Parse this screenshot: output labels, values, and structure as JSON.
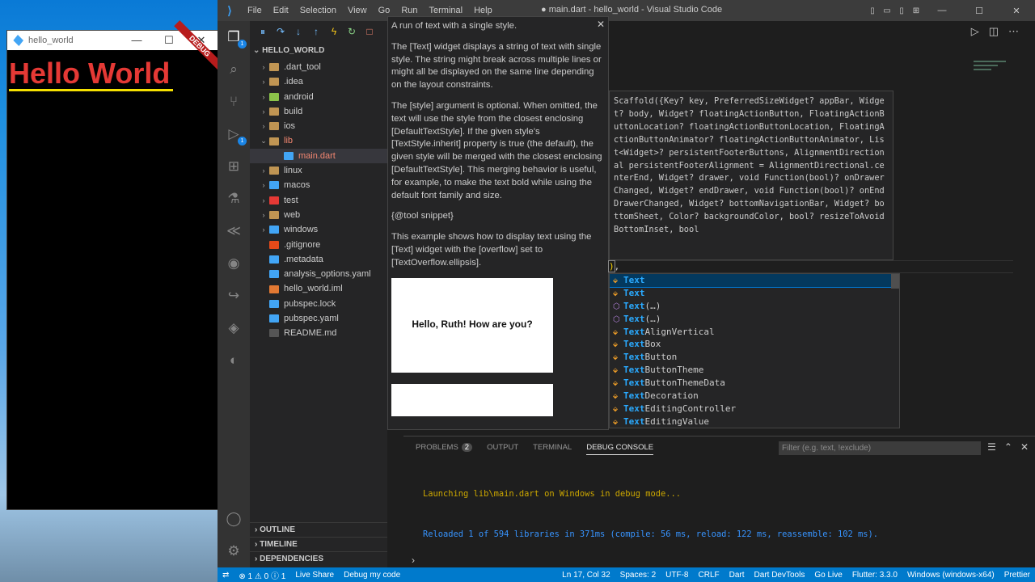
{
  "app_window": {
    "title": "hello_world",
    "hello_text": "Hello World",
    "debug_banner": "DEBUG",
    "minimize": "—",
    "maximize": "☐",
    "close": "✕"
  },
  "vscode": {
    "menus": [
      "File",
      "Edit",
      "Selection",
      "View",
      "Go",
      "Run",
      "Terminal",
      "Help"
    ],
    "title": "● main.dart - hello_world - Visual Studio Code",
    "activity_badges": {
      "explorer": "1",
      "run": "1"
    }
  },
  "explorer": {
    "root": "HELLO_WORLD",
    "items": [
      {
        "label": ".dart_tool",
        "chev": "›",
        "color": "#c09553"
      },
      {
        "label": ".idea",
        "chev": "›",
        "color": "#c09553"
      },
      {
        "label": "android",
        "chev": "›",
        "color": "#8bc34a"
      },
      {
        "label": "build",
        "chev": "›",
        "color": "#c09553"
      },
      {
        "label": "ios",
        "chev": "›",
        "color": "#c09553"
      },
      {
        "label": "lib",
        "chev": "⌄",
        "color": "#c09553"
      },
      {
        "label": "main.dart",
        "chev": "",
        "color": "#42a5f5"
      },
      {
        "label": "linux",
        "chev": "›",
        "color": "#c09553"
      },
      {
        "label": "macos",
        "chev": "›",
        "color": "#42a5f5"
      },
      {
        "label": "test",
        "chev": "›",
        "color": "#e53935"
      },
      {
        "label": "web",
        "chev": "›",
        "color": "#c09553"
      },
      {
        "label": "windows",
        "chev": "›",
        "color": "#42a5f5"
      },
      {
        "label": ".gitignore",
        "chev": "",
        "color": "#e64a19"
      },
      {
        "label": ".metadata",
        "chev": "",
        "color": "#42a5f5"
      },
      {
        "label": "analysis_options.yaml",
        "chev": "",
        "color": "#42a5f5"
      },
      {
        "label": "hello_world.iml",
        "chev": "",
        "color": "#e37933"
      },
      {
        "label": "pubspec.lock",
        "chev": "",
        "color": "#42a5f5"
      },
      {
        "label": "pubspec.yaml",
        "chev": "",
        "color": "#42a5f5"
      },
      {
        "label": "README.md",
        "chev": "",
        "color": "#555555"
      }
    ],
    "sections": [
      "OUTLINE",
      "TIMELINE",
      "DEPENDENCIES"
    ]
  },
  "hover_doc": {
    "paragraphs": [
      "A run of text with a single style.",
      "The [Text] widget displays a string of text with single style. The string might break across multiple lines or might all be displayed on the same line depending on the layout constraints.",
      "The [style] argument is optional. When omitted, the text will use the style from the closest enclosing [DefaultTextStyle]. If the given style's [TextStyle.inherit] property is true (the default), the given style will be merged with the closest enclosing [DefaultTextStyle]. This merging behavior is useful, for example, to make the text bold while using the default font family and size.",
      "{@tool snippet}",
      "This example shows how to display text using the [Text] widget with the [overflow] set to [TextOverflow.ellipsis]."
    ],
    "example_text": "Hello, Ruth! How are you?",
    "close": "✕"
  },
  "signature_help": "Scaffold({Key? key, PreferredSizeWidget? appBar, Widget? body, Widget? floatingActionButton, FloatingActionButtonLocation? floatingActionButtonLocation, FloatingActionButtonAnimator? floatingActionButtonAnimator, List<Widget>? persistentFooterButtons, AlignmentDirectional persistentFooterAlignment = AlignmentDirectional.centerEnd, Widget? drawer, void Function(bool)? onDrawerChanged, Widget? endDrawer, void Function(bool)? onEndDrawerChanged, Widget? bottomNavigationBar, Widget? bottomSheet, Color? backgroundColor, bool? resizeToAvoidBottomInset, bool",
  "code_line": {
    "bracket": ")",
    "rest": ","
  },
  "suggestions": [
    {
      "prefix": "Text",
      "rest": "",
      "kind": "class"
    },
    {
      "prefix": "Text",
      "rest": "",
      "kind": "class"
    },
    {
      "prefix": "Text",
      "rest": "(…)",
      "kind": "method"
    },
    {
      "prefix": "Text",
      "rest": "(…)",
      "kind": "method"
    },
    {
      "prefix": "Text",
      "rest": "AlignVertical",
      "kind": "class"
    },
    {
      "prefix": "Text",
      "rest": "Box",
      "kind": "class"
    },
    {
      "prefix": "Text",
      "rest": "Button",
      "kind": "class"
    },
    {
      "prefix": "Text",
      "rest": "ButtonTheme",
      "kind": "class"
    },
    {
      "prefix": "Text",
      "rest": "ButtonThemeData",
      "kind": "class"
    },
    {
      "prefix": "Text",
      "rest": "Decoration",
      "kind": "class"
    },
    {
      "prefix": "Text",
      "rest": "EditingController",
      "kind": "class"
    },
    {
      "prefix": "Text",
      "rest": "EditingValue",
      "kind": "class"
    }
  ],
  "panel": {
    "tabs": [
      "PROBLEMS",
      "OUTPUT",
      "TERMINAL",
      "DEBUG CONSOLE"
    ],
    "problems_count": "2",
    "filter_placeholder": "Filter (e.g. text, !exclude)",
    "console": [
      "Launching lib\\main.dart on Windows in debug mode...",
      "Reloaded 1 of 594 libraries in 371ms (compile: 56 ms, reload: 122 ms, reassemble: 102 ms)."
    ],
    "prompt": "›"
  },
  "statusbar": {
    "left": [
      "⊗ 1 ⚠ 0 ⓘ 1",
      "Live Share",
      "Debug my code"
    ],
    "right": [
      "Ln 17, Col 32",
      "Spaces: 2",
      "UTF-8",
      "CRLF",
      "Dart",
      "Dart DevTools",
      "Go Live",
      "Flutter: 3.3.0",
      "Windows (windows-x64)",
      "Prettier"
    ]
  }
}
